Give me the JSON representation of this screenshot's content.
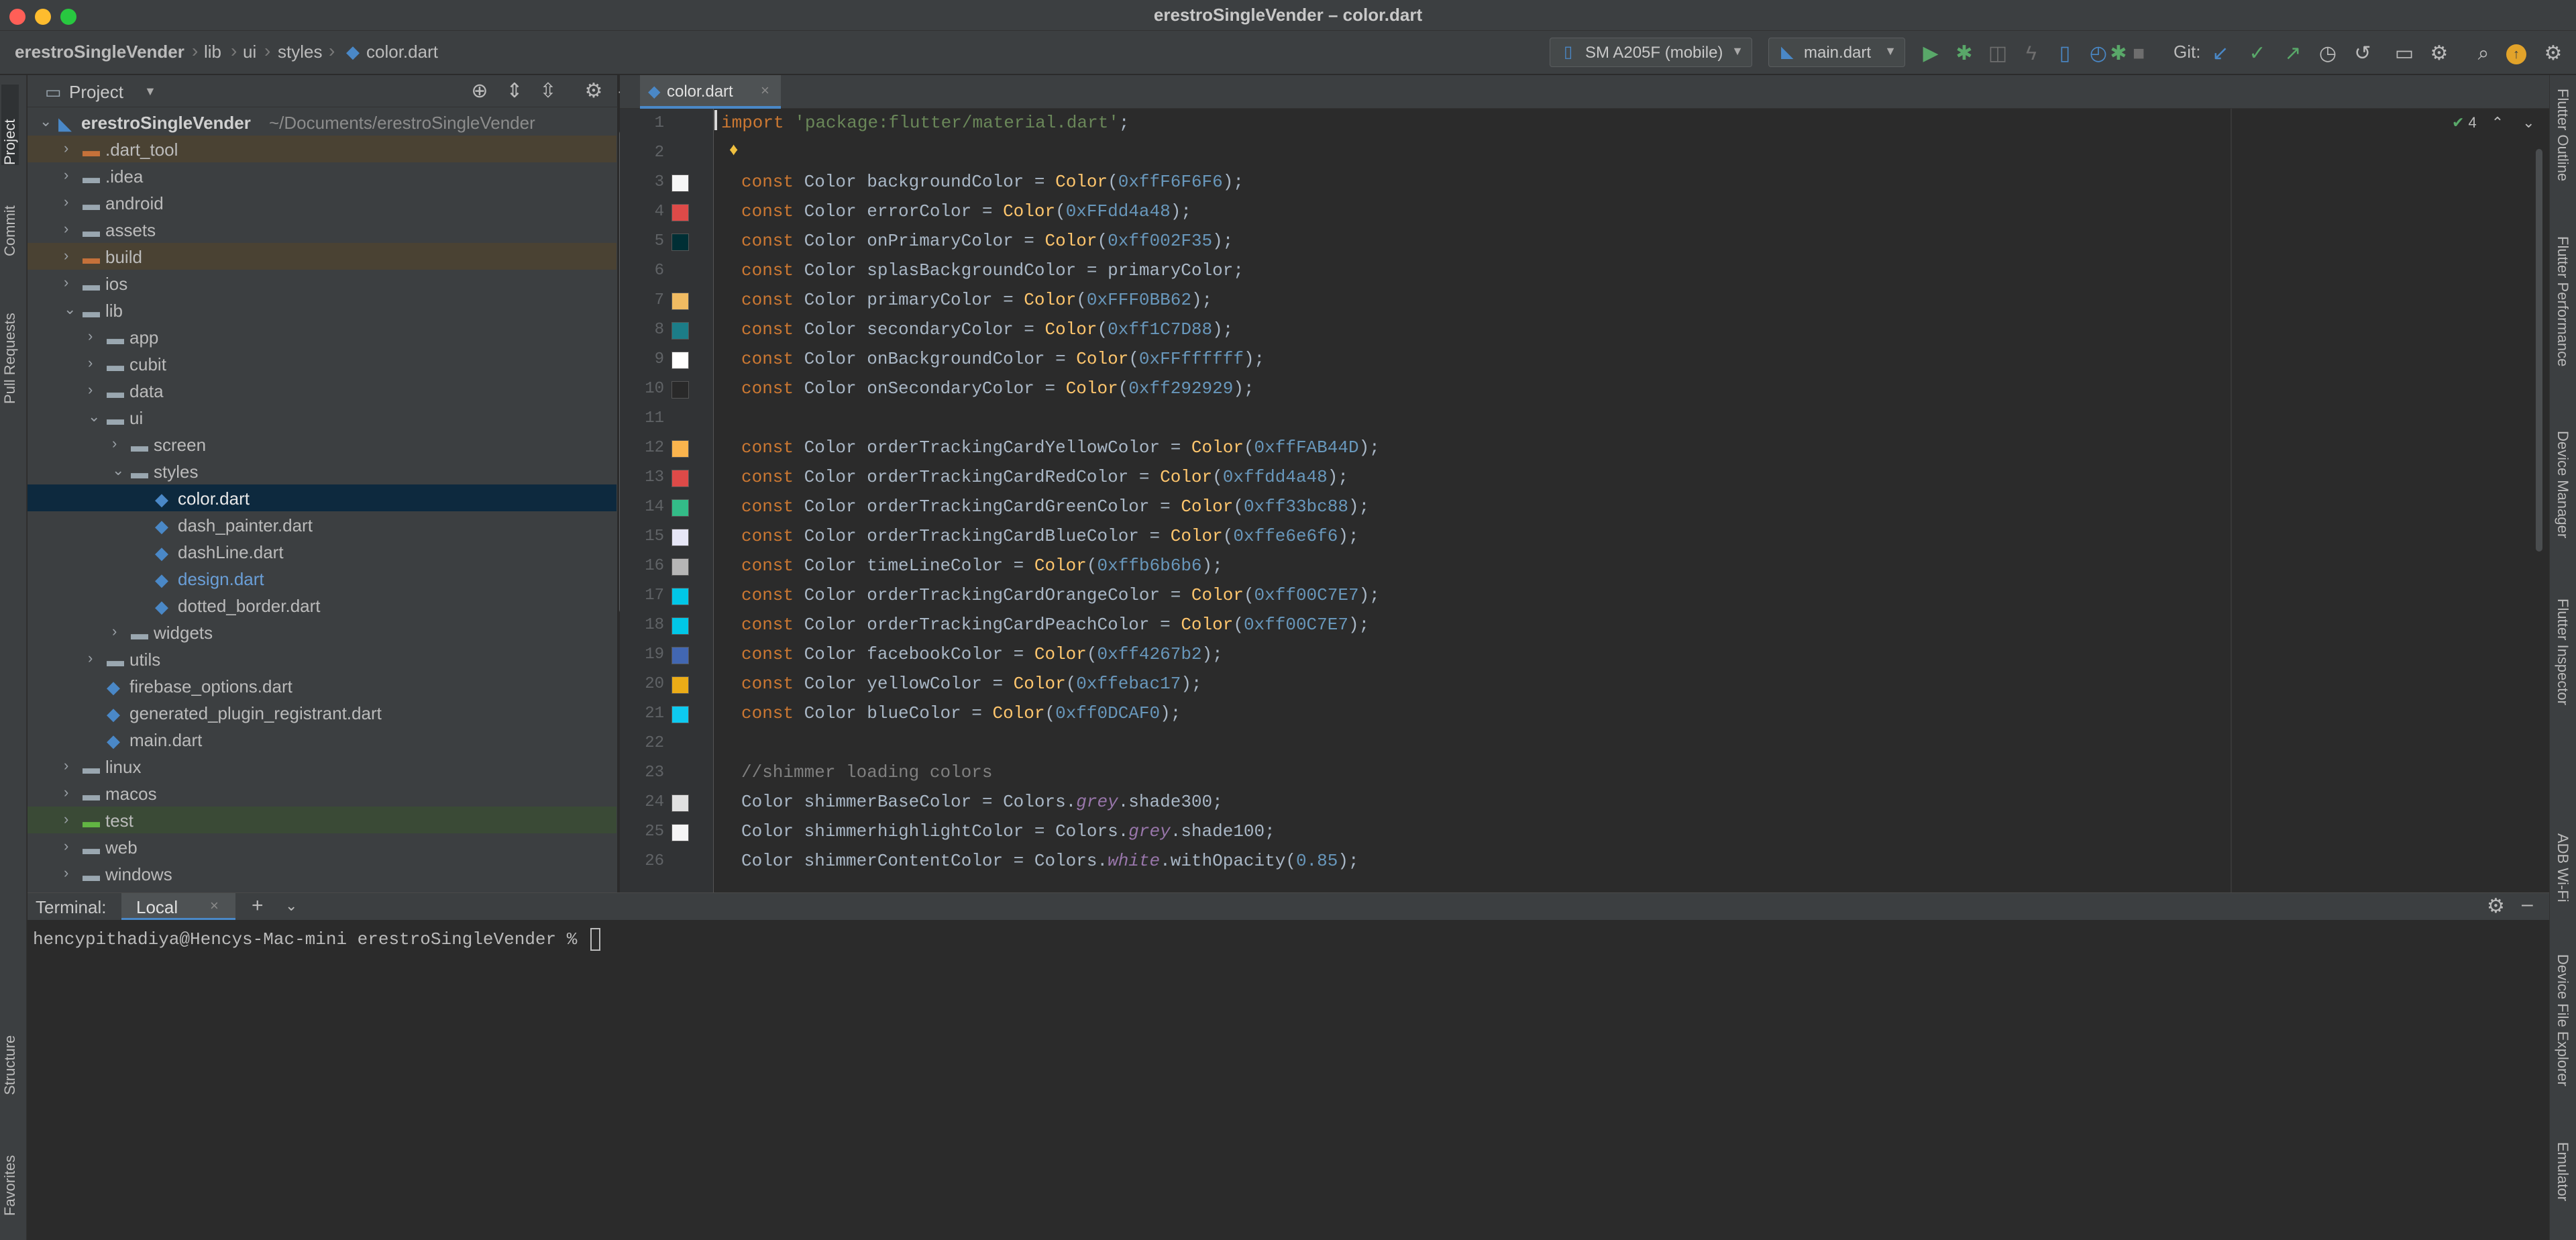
{
  "window": {
    "title": "erestroSingleVender – color.dart"
  },
  "breadcrumb": [
    "erestroSingleVender",
    "lib",
    "ui",
    "styles",
    "color.dart"
  ],
  "toolbar": {
    "device": "SM A205F (mobile)",
    "run_config": "main.dart",
    "git_label": "Git:"
  },
  "left_tabs": [
    "Project",
    "Commit",
    "Pull Requests",
    "Structure",
    "Favorites"
  ],
  "right_tabs": [
    "Flutter Outline",
    "Flutter Performance",
    "Device Manager",
    "Flutter Inspector",
    "ADB Wi-Fi",
    "Device File Explorer",
    "Emulator"
  ],
  "project": {
    "title": "Project",
    "root_name": "erestroSingleVender",
    "root_path": "~/Documents/erestroSingleVender",
    "items": [
      {
        "label": "root",
        "type": "root"
      },
      {
        "label": ".dart_tool",
        "type": "folder-orange"
      },
      {
        "label": ".idea",
        "type": "folder"
      },
      {
        "label": "android",
        "type": "folder"
      },
      {
        "label": "assets",
        "type": "folder"
      },
      {
        "label": "build",
        "type": "folder-orange"
      },
      {
        "label": "ios",
        "type": "folder"
      },
      {
        "label": "lib",
        "type": "folder-open"
      },
      {
        "label": "app",
        "type": "folder"
      },
      {
        "label": "cubit",
        "type": "folder"
      },
      {
        "label": "data",
        "type": "folder"
      },
      {
        "label": "ui",
        "type": "folder-open"
      },
      {
        "label": "screen",
        "type": "folder"
      },
      {
        "label": "styles",
        "type": "folder-open"
      },
      {
        "label": "color.dart",
        "type": "dart"
      },
      {
        "label": "dash_painter.dart",
        "type": "dart"
      },
      {
        "label": "dashLine.dart",
        "type": "dart"
      },
      {
        "label": "design.dart",
        "type": "dart-blue"
      },
      {
        "label": "dotted_border.dart",
        "type": "dart"
      },
      {
        "label": "widgets",
        "type": "folder"
      },
      {
        "label": "utils",
        "type": "folder"
      },
      {
        "label": "firebase_options.dart",
        "type": "dart"
      },
      {
        "label": "generated_plugin_registrant.dart",
        "type": "dart"
      },
      {
        "label": "main.dart",
        "type": "dart"
      },
      {
        "label": "linux",
        "type": "folder"
      },
      {
        "label": "macos",
        "type": "folder"
      },
      {
        "label": "test",
        "type": "folder-green"
      },
      {
        "label": "web",
        "type": "folder"
      },
      {
        "label": "windows",
        "type": "folder"
      }
    ]
  },
  "editor": {
    "tab": "color.dart",
    "inspection_count": "4",
    "lines": [
      {
        "n": "1",
        "html": "<span class=\"kw\">import</span> <span class=\"str\">'package:flutter/material.dart'</span>;",
        "swatch": ""
      },
      {
        "n": "2",
        "html": "",
        "swatch": ""
      },
      {
        "n": "3",
        "html": "<span class=\"kw\">const</span> Color backgroundColor = <span class=\"fn\">Color</span>(<span class=\"num\">0xffF6F6F6</span>);",
        "swatch": "#F6F6F6"
      },
      {
        "n": "4",
        "html": "<span class=\"kw\">const</span> Color errorColor = <span class=\"fn\">Color</span>(<span class=\"num\">0xFFdd4a48</span>);",
        "swatch": "#dd4a48"
      },
      {
        "n": "5",
        "html": "<span class=\"kw\">const</span> Color onPrimaryColor = <span class=\"fn\">Color</span>(<span class=\"num\">0xff002F35</span>);",
        "swatch": "#002F35"
      },
      {
        "n": "6",
        "html": "<span class=\"kw\">const</span> Color splasBackgroundColor = primaryColor;",
        "swatch": ""
      },
      {
        "n": "7",
        "html": "<span class=\"kw\">const</span> Color primaryColor = <span class=\"fn\">Color</span>(<span class=\"num\">0xFFF0BB62</span>);",
        "swatch": "#F0BB62"
      },
      {
        "n": "8",
        "html": "<span class=\"kw\">const</span> Color secondaryColor = <span class=\"fn\">Color</span>(<span class=\"num\">0xff1C7D88</span>);",
        "swatch": "#1C7D88"
      },
      {
        "n": "9",
        "html": "<span class=\"kw\">const</span> Color onBackgroundColor = <span class=\"fn\">Color</span>(<span class=\"num\">0xFFffffff</span>);",
        "swatch": "#ffffff"
      },
      {
        "n": "10",
        "html": "<span class=\"kw\">const</span> Color onSecondaryColor = <span class=\"fn\">Color</span>(<span class=\"num\">0xff292929</span>);",
        "swatch": "#292929"
      },
      {
        "n": "11",
        "html": "",
        "swatch": ""
      },
      {
        "n": "12",
        "html": "<span class=\"kw\">const</span> Color orderTrackingCardYellowColor = <span class=\"fn\">Color</span>(<span class=\"num\">0xffFAB44D</span>);",
        "swatch": "#FAB44D"
      },
      {
        "n": "13",
        "html": "<span class=\"kw\">const</span> Color orderTrackingCardRedColor = <span class=\"fn\">Color</span>(<span class=\"num\">0xffdd4a48</span>);",
        "swatch": "#dd4a48"
      },
      {
        "n": "14",
        "html": "<span class=\"kw\">const</span> Color orderTrackingCardGreenColor = <span class=\"fn\">Color</span>(<span class=\"num\">0xff33bc88</span>);",
        "swatch": "#33bc88"
      },
      {
        "n": "15",
        "html": "<span class=\"kw\">const</span> Color orderTrackingCardBlueColor = <span class=\"fn\">Color</span>(<span class=\"num\">0xffe6e6f6</span>);",
        "swatch": "#e6e6f6"
      },
      {
        "n": "16",
        "html": "<span class=\"kw\">const</span> Color timeLineColor = <span class=\"fn\">Color</span>(<span class=\"num\">0xffb6b6b6</span>);",
        "swatch": "#b6b6b6"
      },
      {
        "n": "17",
        "html": "<span class=\"kw\">const</span> Color orderTrackingCardOrangeColor = <span class=\"fn\">Color</span>(<span class=\"num\">0xff00C7E7</span>);",
        "swatch": "#00C7E7"
      },
      {
        "n": "18",
        "html": "<span class=\"kw\">const</span> Color orderTrackingCardPeachColor = <span class=\"fn\">Color</span>(<span class=\"num\">0xff00C7E7</span>);",
        "swatch": "#00C7E7"
      },
      {
        "n": "19",
        "html": "<span class=\"kw\">const</span> Color facebookColor = <span class=\"fn\">Color</span>(<span class=\"num\">0xff4267b2</span>);",
        "swatch": "#4267b2"
      },
      {
        "n": "20",
        "html": "<span class=\"kw\">const</span> Color yellowColor = <span class=\"fn\">Color</span>(<span class=\"num\">0xffebac17</span>);",
        "swatch": "#ebac17"
      },
      {
        "n": "21",
        "html": "<span class=\"kw\">const</span> Color blueColor = <span class=\"fn\">Color</span>(<span class=\"num\">0xff0DCAF0</span>);",
        "swatch": "#0DCAF0"
      },
      {
        "n": "22",
        "html": "",
        "swatch": ""
      },
      {
        "n": "23",
        "html": "<span class=\"cm\">//shimmer loading colors</span>",
        "swatch": ""
      },
      {
        "n": "24",
        "html": "Color shimmerBaseColor = Colors.<span class=\"it\">grey</span>.shade300;",
        "swatch": "#e0e0e0"
      },
      {
        "n": "25",
        "html": "Color shimmerhighlightColor = Colors.<span class=\"it\">grey</span>.shade100;",
        "swatch": "#f5f5f5"
      },
      {
        "n": "26",
        "html": "Color shimmerContentColor = Colors.<span class=\"it\">white</span>.withOpacity(<span class=\"num\">0.85</span>);",
        "swatch": ""
      }
    ]
  },
  "terminal": {
    "label": "Terminal:",
    "tab": "Local",
    "prompt": "hencypithadiya@Hencys-Mac-mini erestroSingleVender % "
  },
  "colors": {
    "accent": "#4a88c7",
    "selection": "#0d293e",
    "run": "#59a869",
    "folder": "#9aa7b0",
    "folder_orange": "#c5713a",
    "folder_green": "#62b543"
  }
}
